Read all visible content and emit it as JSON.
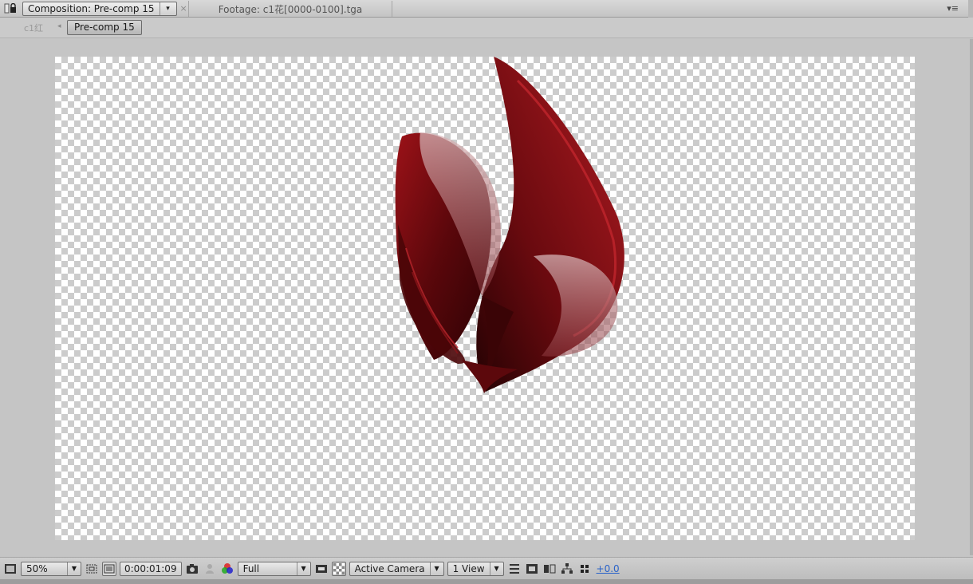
{
  "tabs": {
    "active_label": "Composition: Pre-comp 15",
    "inactive_label": "Footage: c1花[0000-0100].tga",
    "close_glyph": "×",
    "dropdown_glyph": "▾",
    "panel_menu_glyph": "▾≡"
  },
  "breadcrumb": {
    "parent": "c1红",
    "separator": "◂",
    "current": "Pre-comp 15"
  },
  "toolbar": {
    "magnification": "50%",
    "timecode": "0:00:01:09",
    "resolution": "Full",
    "view": "Active Camera",
    "layout": "1 View",
    "exposure": "+0.0",
    "icons": [
      "always-preview-icon",
      "region-of-interest-icon",
      "transparency-grid-icon",
      "snapshot-icon",
      "show-snapshot-icon",
      "channel-icon",
      "fast-previews-icon",
      "toggle-transparency-grid-icon",
      "timeline-icon",
      "comp-flowchart-icon",
      "reset-exposure-icon"
    ]
  },
  "colors": {
    "panel_bg": "#c5c5c5",
    "flower_dark": "#3a0406",
    "flower_mid": "#8a0f14",
    "flower_light": "#c2323a",
    "exposure_link": "#2a63c9"
  }
}
